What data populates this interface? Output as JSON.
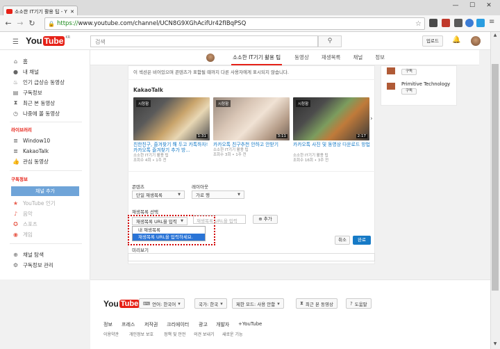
{
  "browser": {
    "tab_title": "소소한 IT기기 활용 팁 - Y",
    "url_scheme": "https://",
    "url_rest": "www.youtube.com/channel/UCN8G9XGhAcifUr42fIBqPSQ",
    "window_controls": [
      "—",
      "☐",
      "✕"
    ]
  },
  "header": {
    "logo_you": "You",
    "logo_tube": "Tube",
    "logo_region": "KR",
    "search_placeholder": "검색",
    "upload_label": "업로드"
  },
  "sidebar": {
    "items": [
      {
        "label": "홈",
        "icon": "home-icon"
      },
      {
        "label": "내 채널",
        "icon": "person-icon"
      },
      {
        "label": "인기 급상승 동영상",
        "icon": "flame-icon"
      },
      {
        "label": "구독정보",
        "icon": "subscriptions-icon"
      },
      {
        "label": "최근 본 동영상",
        "icon": "history-icon"
      },
      {
        "label": "나중에 볼 동영상",
        "icon": "clock-icon"
      }
    ],
    "library_heading": "라이브러리",
    "library": [
      {
        "label": "Window10"
      },
      {
        "label": "KakaoTalk"
      },
      {
        "label": "관심 동영상"
      }
    ],
    "subs_heading": "구독정보",
    "add_channel": "채널 추가",
    "subs": [
      {
        "label": "YouTube 인기"
      },
      {
        "label": "음악"
      },
      {
        "label": "스포츠"
      },
      {
        "label": "게임"
      }
    ],
    "bottom": [
      {
        "label": "채널 탐색"
      },
      {
        "label": "구독정보 관리"
      }
    ]
  },
  "channel_tabs": {
    "items": [
      "소소한 IT기기 활용 팁",
      "동영상",
      "재생목록",
      "채널",
      "정보"
    ]
  },
  "main": {
    "section_note": "이 섹션은 비어있으며 콘텐츠가 표함될 때까지 다른 사용자에게 표시되지 않습니다.",
    "playlist_title": "KakaoTalk",
    "videos": [
      {
        "tag": "시청함",
        "duration": "1:31",
        "title": "친한친구, 즐겨찾기 해 두고 카톡하자! 카카오톡 즐겨찾기 추가 방...",
        "channel": "소소한 IT기기 활용 팁",
        "meta": "조회수 4회 • 1주 전"
      },
      {
        "tag": "시청함",
        "duration": "3:11",
        "title": "카카오톡 친구추천 안하고 안받기",
        "channel": "소소한 IT기기 활용 팁",
        "meta": "조회수 3회 • 1주 전"
      },
      {
        "tag": "시청함",
        "duration": "2:17",
        "title": "카카오톡 사진 및 동영상 다운로드 방법",
        "channel": "소소한 IT기기 활용 팁",
        "meta": "조회수 16회 • 3주 전"
      }
    ],
    "carousel_next": "›",
    "content_label": "콘텐츠",
    "content_value": "단일 재생목록",
    "layout_label": "레이아웃",
    "layout_value": "가로 행",
    "playlist_select_label": "재생목록 선택",
    "playlist_select_value": "재생목록 URL을 입력",
    "dropdown_options": [
      "내 재생목록",
      "재생목록 URL을 입력하세요."
    ],
    "url_placeholder": "재생목록 URL을 입력",
    "add_label": "추가",
    "cancel_label": "취소",
    "done_label": "완료",
    "preview_label": "미리보기"
  },
  "right": {
    "channel_name": "Primitive Technology",
    "subscribe_label": "구독"
  },
  "footer": {
    "logo_you": "You",
    "logo_tube": "Tube",
    "language": "언어: 한국어",
    "country": "국가: 한국",
    "restricted": "제한 모드: 사용 안함",
    "history": "최근 본 동영상",
    "help": "도움말",
    "links1": [
      "정보",
      "프레스",
      "저작권",
      "크리에이터",
      "광고",
      "개발자",
      "+YouTube"
    ],
    "links2": [
      "이용약관",
      "개인정보 보호",
      "정책 및 안전",
      "의견 보내기",
      "새로운 기능"
    ]
  },
  "colors": {
    "youtube_red": "#e62117",
    "link_blue": "#167ac6",
    "highlight_blue": "#2a74d6",
    "dotted_frame": "#d20000"
  }
}
